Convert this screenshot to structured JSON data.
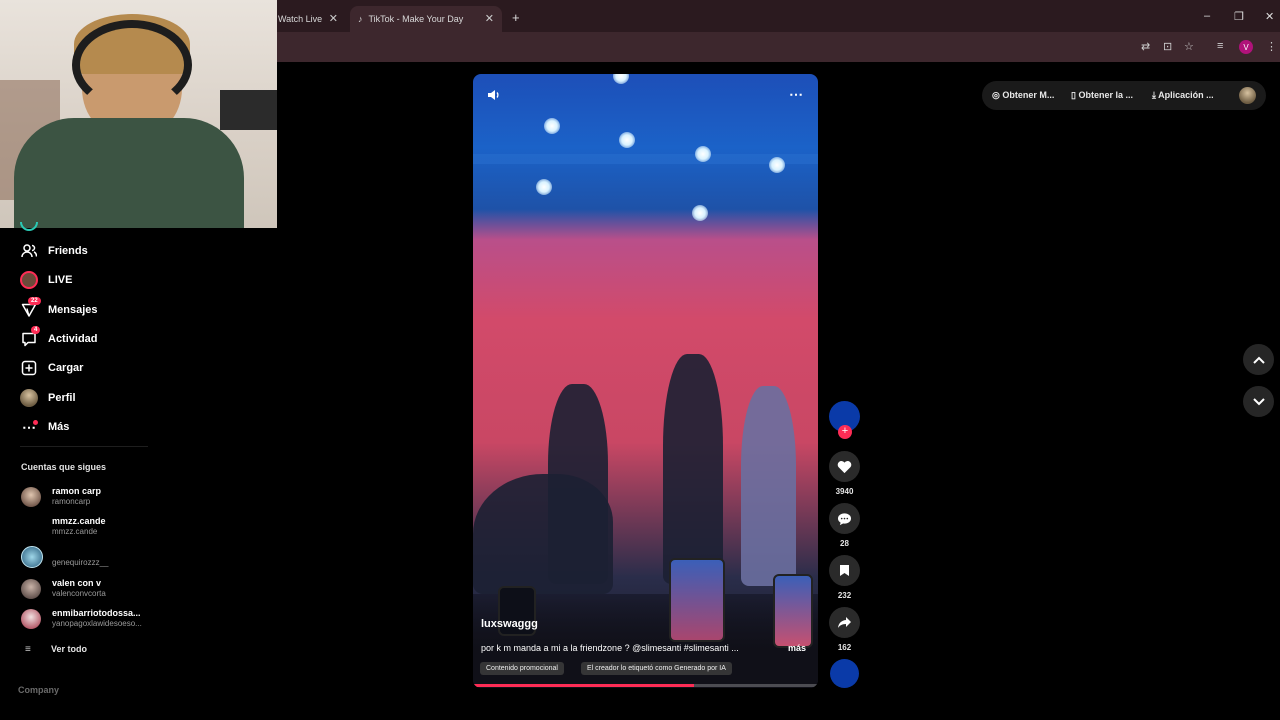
{
  "browser": {
    "tabs": [
      {
        "label": "Watch Live"
      },
      {
        "label": "TikTok - Make Your Day"
      }
    ],
    "new_tab": "+",
    "window": {
      "minimize": "–",
      "restore": "❐",
      "close": "✕"
    },
    "profile_initial": "V"
  },
  "sidebar": {
    "items": [
      {
        "label": "Friends"
      },
      {
        "label": "LIVE"
      },
      {
        "label": "Mensajes",
        "badge": "22"
      },
      {
        "label": "Actividad",
        "badge": "4"
      },
      {
        "label": "Cargar"
      },
      {
        "label": "Perfil"
      },
      {
        "label": "Más"
      }
    ],
    "following_title": "Cuentas que sigues",
    "following": [
      {
        "name": "ramon carp",
        "username": "ramoncarp"
      },
      {
        "name": "mmzz.cande",
        "username": "mmzz.cande"
      },
      {
        "name": "",
        "username": "genequirozzz__"
      },
      {
        "name": "valen con v",
        "username": "valenconvcorta"
      },
      {
        "name": "enmibarriotodossa...",
        "username": "yanopagoxlawidesoeso..."
      }
    ],
    "see_all": "Ver todo",
    "footer": "Company"
  },
  "top_actions": [
    {
      "label": "Obtener M..."
    },
    {
      "label": "Obtener la ..."
    },
    {
      "label": "Aplicación ..."
    }
  ],
  "video": {
    "author": "luxswaggg",
    "caption": "por k m manda a mi a la friendzone ? @slimesanti #slimesanti ...",
    "more": "más",
    "tags": [
      "Contenido promocional",
      "El creador lo etiquetó como Generado por IA"
    ],
    "progress": 0.64
  },
  "actions": {
    "likes": "3940",
    "comments": "28",
    "saves": "232",
    "shares": "162"
  },
  "colors": {
    "accent": "#fe2c55",
    "avatar": "#0a3aa8"
  }
}
